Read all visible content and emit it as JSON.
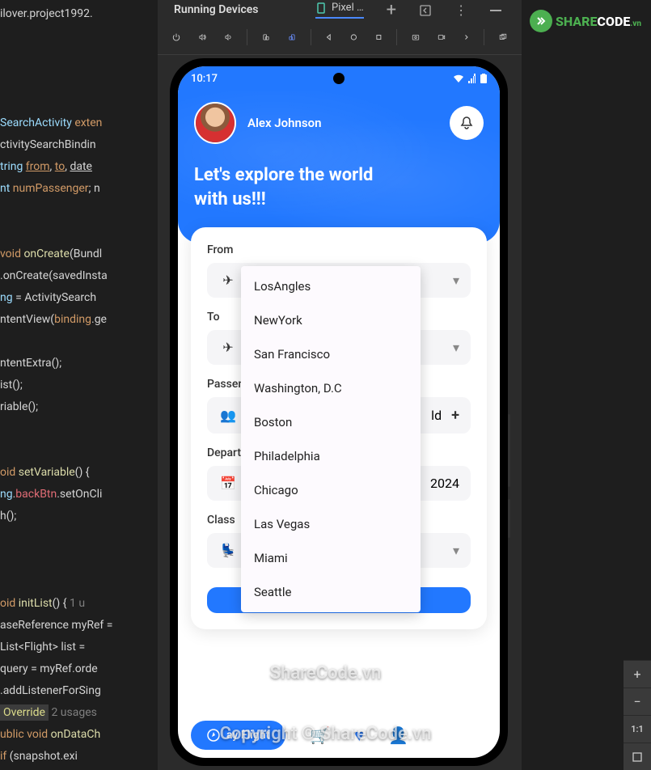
{
  "ide": {
    "panel_title": "Running Devices",
    "tab_label": "Pixel …",
    "code_lines": {
      "l1": "ilover.project1992.",
      "l2_a": "SearchActivity ",
      "l2_b": "exten",
      "l3": "ctivitySearchBindin",
      "l4_a": "tring ",
      "l4_b": "from",
      "l4_c": ", ",
      "l4_d": "to",
      "l4_e": ", ",
      "l4_f": "date",
      "l5_a": "nt ",
      "l5_b": "numPassenger",
      "l5_c": ";   n",
      "l6_a": "  void ",
      "l6_b": "onCreate",
      "l6_c": "(Bundl",
      "l7_a": ".onCreate",
      "l7_b": "(savedInsta",
      "l8_a": "ng",
      "l8_b": " = ActivitySearch",
      "l9_a": "ntentView(",
      "l9_b": "binding",
      "l9_c": ".ge",
      "l10": "ntentExtra();",
      "l11": "ist();",
      "l12": "riable();",
      "l13_a": "oid ",
      "l13_b": "setVariable",
      "l13_c": "() {",
      "l14_a": "ng",
      "l14_b": ".",
      "l14_c": "backBtn",
      "l14_d": ".setOnCli",
      "l15": "h();",
      "l16_a": "oid ",
      "l16_b": "initList",
      "l16_c": "() {   ",
      "l16_d": "1 u",
      "l17": "aseReference myRef =",
      "l18": "List<Flight> list =",
      "l19": " query = myRef.orde",
      "l20": ".addListenerForSing",
      "l21_a": "Override",
      "l21_b": "  2 usages",
      "l22_a": "ublic ",
      "l22_b": "void ",
      "l22_c": "onDataCh",
      "l23_a": "    if",
      "l23_b": " (snapshot.exi"
    }
  },
  "phone": {
    "time": "10:17",
    "username": "Alex Johnson",
    "hero_line1": "Let's explore the world",
    "hero_line2": " with us!!!",
    "labels": {
      "from": "From",
      "to": "To",
      "passengers": "Passeng",
      "departure": "Departu",
      "class": "Class"
    },
    "return_date": "2024",
    "child_label": "ld",
    "dropdown": [
      "LosAngles",
      "NewYork",
      "San Francisco",
      "Washington, D.C",
      "Boston",
      "Philadelphia",
      "Chicago",
      "Las Vegas",
      "Miami",
      "Seattle"
    ],
    "bottom_nav_label": "ay Flight"
  },
  "watermarks": {
    "w1": "ShareCode.vn",
    "w2": "Copyright © ShareCode.vn"
  },
  "zoom": {
    "ratio": "1:1"
  },
  "logo": {
    "part1": "SHARE",
    "part2": "CODE",
    "part3": ".vn"
  }
}
